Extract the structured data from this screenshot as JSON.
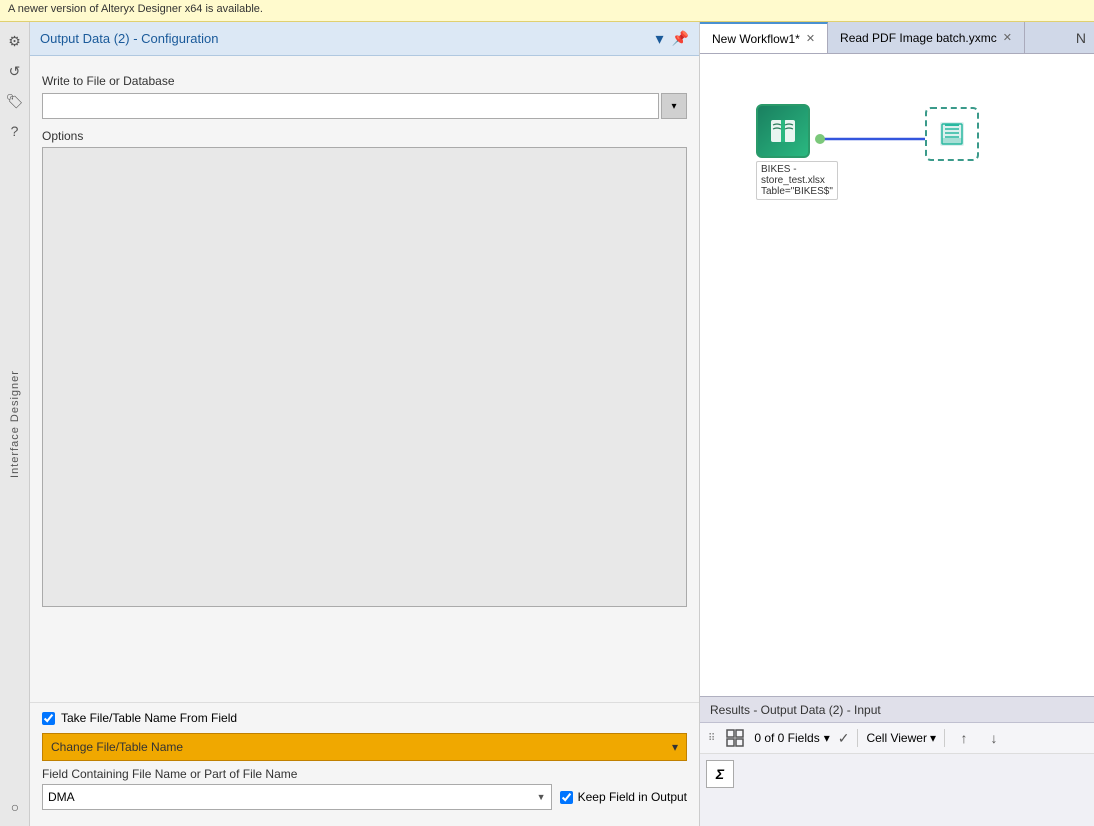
{
  "banner": {
    "text": "A newer version of Alteryx Designer x64 is available."
  },
  "sidebar": {
    "label": "Interface Designer",
    "icons": [
      {
        "name": "gear-icon",
        "symbol": "⚙"
      },
      {
        "name": "refresh-icon",
        "symbol": "↺"
      },
      {
        "name": "tag-icon",
        "symbol": "🏷"
      },
      {
        "name": "help-icon",
        "symbol": "?"
      },
      {
        "name": "circle-icon",
        "symbol": "○"
      }
    ]
  },
  "config": {
    "title": "Output Data (2) - Configuration",
    "header_icons": {
      "dropdown_icon": "▾",
      "pin_icon": "📌"
    },
    "write_to_label": "Write to File or Database",
    "file_placeholder": "",
    "options_label": "Options",
    "take_file_checkbox": true,
    "take_file_label": "Take File/Table Name From Field",
    "change_file_label": "Change File/Table Name",
    "field_containing_label": "Field Containing File Name or Part of File Name",
    "dma_field_value": "DMA",
    "keep_field_label": "Keep Field in Output",
    "keep_field_checked": true
  },
  "workflow": {
    "tabs": [
      {
        "label": "New Workflow1*",
        "active": true,
        "closable": true
      },
      {
        "label": "Read PDF Image batch.yxmc",
        "active": false,
        "closable": true
      }
    ],
    "nodes": {
      "input_node": {
        "label_lines": [
          "BIKES -",
          "store_test.xlsx",
          "Table=\"BIKES$\""
        ]
      },
      "output_node": {
        "label": ""
      }
    },
    "connector_color": "#5555ee"
  },
  "results": {
    "header": "Results - Output Data (2) - Input",
    "fields_text": "0 of 0 Fields",
    "fields_dropdown": "▾",
    "check_label": "✓",
    "cell_viewer_label": "Cell Viewer",
    "cell_viewer_dropdown": "▾",
    "sigma_label": "Σ"
  }
}
